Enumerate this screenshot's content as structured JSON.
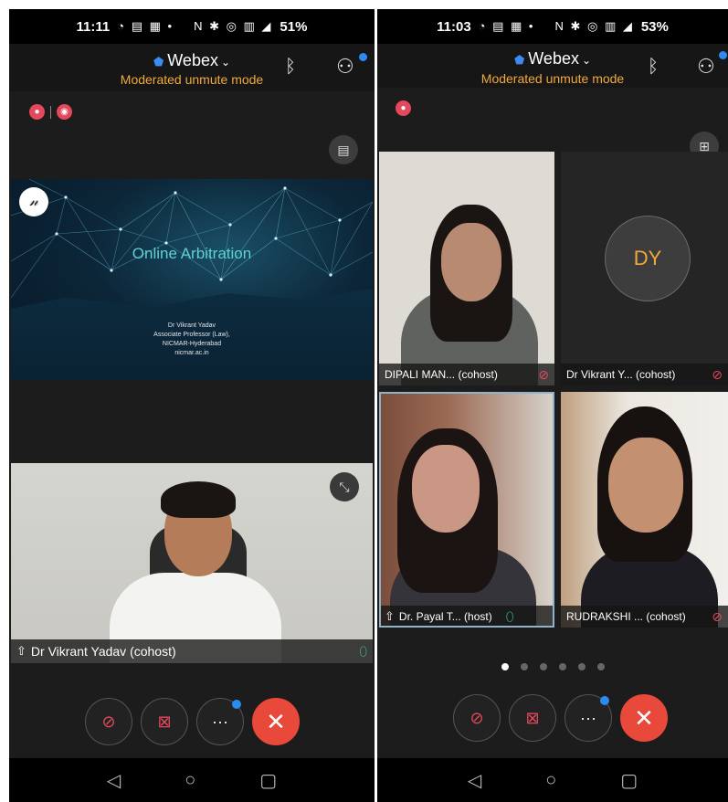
{
  "left": {
    "status_time": "11:11",
    "status_icons": "◔ ▤ ▦ •",
    "status_right_icons": "N ✱ ◎ ▥ ◢",
    "battery": "51%",
    "app_title": "Webex",
    "mode": "Moderated unmute mode",
    "slide": {
      "title": "Online Arbitration",
      "line1": "Dr Vikrant Yadav",
      "line2": "Associate Professor (Law),",
      "line3": "NICMAR-Hyderabad",
      "line4": "nicmar.ac.in"
    },
    "video_label": "Dr Vikrant Yadav (cohost)"
  },
  "right": {
    "status_time": "11:03",
    "status_icons": "◔ ▤ ▦ •",
    "status_right_icons": "N ✱ ◎ ▥ ◢",
    "battery": "53%",
    "app_title": "Webex",
    "mode": "Moderated unmute mode",
    "tiles": [
      {
        "label": "DIPALI MAN... (cohost)",
        "mic": "muted"
      },
      {
        "label": "Dr Vikrant Y... (cohost)",
        "mic": "muted",
        "avatar": "DY"
      },
      {
        "label": "Dr. Payal T... (host)",
        "mic": "on"
      },
      {
        "label": "RUDRAKSHI ... (cohost)",
        "mic": "muted"
      }
    ],
    "pages_total": 6,
    "page_active": 1
  },
  "controls": {
    "more_label": "···",
    "end_label": "✕"
  },
  "icons": {
    "shield": "shield-icon",
    "bluetooth": "bluetooth-icon",
    "participants": "participants-icon",
    "layout": "layout-icon",
    "annotate": "annotate-icon",
    "fullscreen": "fullscreen-icon",
    "mute": "mic-muted-lock-icon",
    "video": "video-off-icon",
    "more": "more-icon",
    "end": "end-call-icon",
    "back": "back-icon",
    "home": "home-icon",
    "recents": "recents-icon"
  },
  "colors": {
    "accent": "#f2a93b",
    "end_call": "#e9493b",
    "muted": "#e4485c",
    "mic_on": "#38c089",
    "notify": "#2b8bf2"
  }
}
